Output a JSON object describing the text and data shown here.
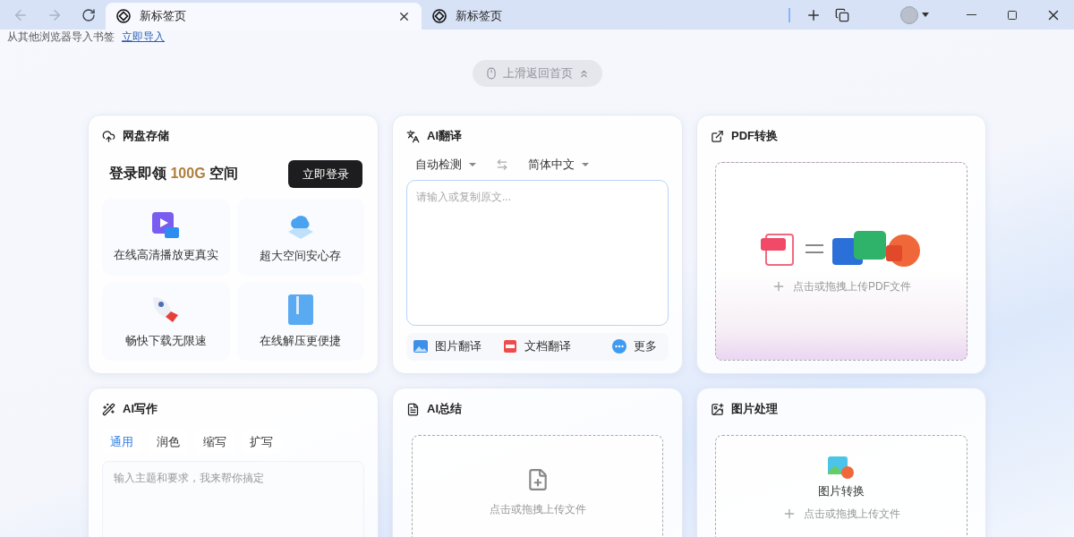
{
  "nav": {
    "back_disabled": true,
    "forward_disabled": true
  },
  "tabs": [
    {
      "title": "新标签页",
      "selected": true
    },
    {
      "title": "新标签页",
      "selected": false
    }
  ],
  "bookmark_bar": {
    "text": "从其他浏览器导入书签",
    "link": "立即导入"
  },
  "scroll_hint": "上滑返回首页",
  "cards": [
    {
      "kind": "storage",
      "title": "网盘存储",
      "promo": {
        "before": "登录即领",
        "highlight": "100G",
        "after": "空间"
      },
      "button": "立即登录",
      "features": [
        {
          "kind": "video",
          "label": "在线高清播放更真实"
        },
        {
          "kind": "cloud",
          "label": "超大空间安心存"
        },
        {
          "kind": "rocket",
          "label": "畅快下载无限速"
        },
        {
          "kind": "zip",
          "label": "在线解压更便捷"
        }
      ]
    },
    {
      "kind": "translate",
      "title": "AI翻译",
      "source": "自动检测",
      "target": "简体中文",
      "placeholder": "请输入或复制原文...",
      "actions": [
        {
          "kind": "image",
          "label": "图片翻译"
        },
        {
          "kind": "doc",
          "label": "文档翻译"
        },
        {
          "kind": "more",
          "label": "更多"
        }
      ]
    },
    {
      "kind": "pdf",
      "title": "PDF转换",
      "upload": "点击或拖拽上传PDF文件"
    },
    {
      "kind": "writing",
      "title": "AI写作",
      "modes": [
        {
          "label": "通用",
          "selected": true
        },
        {
          "label": "润色",
          "selected": false
        },
        {
          "label": "缩写",
          "selected": false
        },
        {
          "label": "扩写",
          "selected": false
        }
      ],
      "placeholder": "输入主题和要求，我来帮你搞定"
    },
    {
      "kind": "summary",
      "title": "AI总结",
      "upload": "点击或拖拽上传文件"
    },
    {
      "kind": "image",
      "title": "图片处理",
      "tool": "图片转换",
      "upload": "点击或拖拽上传文件"
    }
  ]
}
